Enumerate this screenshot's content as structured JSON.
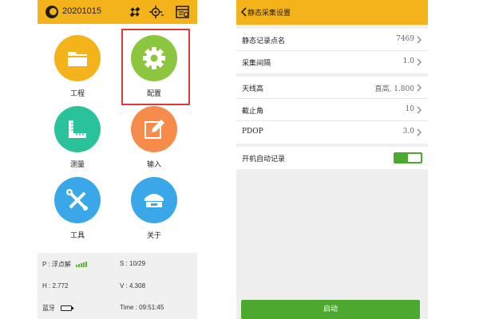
{
  "left_screen": {
    "topbar": {
      "date": "20201015",
      "icons": [
        "app-logo-icon",
        "satellite-icon",
        "gps-crosshair-icon",
        "data-settings-icon"
      ],
      "background": "#f5b31b"
    },
    "tiles": [
      {
        "label": "工程",
        "icon": "folder-icon",
        "color": "#f5b31b"
      },
      {
        "label": "配置",
        "icon": "gear-icon",
        "color": "#8cc63f",
        "selected": true
      },
      {
        "label": "测量",
        "icon": "ruler-icon",
        "color": "#29c29b"
      },
      {
        "label": "输入",
        "icon": "edit-icon",
        "color": "#f58c4c"
      },
      {
        "label": "工具",
        "icon": "tools-icon",
        "color": "#3aa7e8"
      },
      {
        "label": "关于",
        "icon": "receiver-icon",
        "color": "#3aa7e8"
      }
    ],
    "status": {
      "p": "P : 浮点解",
      "s": "S : 10/29",
      "h": "H : 2.772",
      "v": "V : 4.308",
      "bt": "蓝牙",
      "time": "Time : 09:51:45"
    }
  },
  "right_screen": {
    "header": {
      "title": "静态采集设置",
      "background": "#f5b31b"
    },
    "group1": [
      {
        "label": "静态记录点名",
        "value": "7469"
      },
      {
        "label": "采集间隔",
        "value": "1.0"
      }
    ],
    "group2": [
      {
        "label": "天线高",
        "value": "直高, 1.800"
      },
      {
        "label": "截止角",
        "value": "10"
      },
      {
        "label": "PDOP",
        "value": "3.0"
      }
    ],
    "auto_record": {
      "label": "开机自动记录",
      "enabled": true,
      "color": "#4ca82f"
    },
    "start_button": "启动"
  }
}
